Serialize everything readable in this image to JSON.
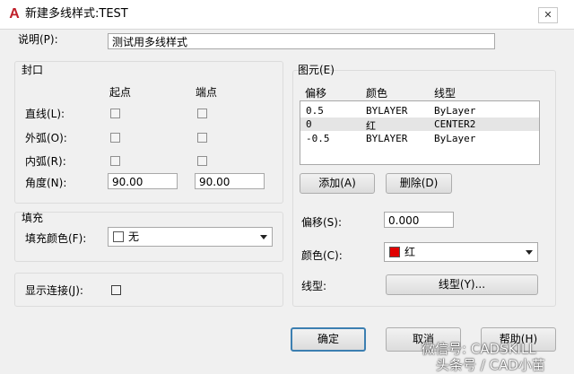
{
  "window": {
    "title": "新建多线样式:TEST",
    "close_glyph": "✕",
    "app_icon_glyph": "A"
  },
  "description": {
    "label": "说明(P):",
    "value": "测试用多线样式"
  },
  "caps": {
    "group_label": "封口",
    "col_start": "起点",
    "col_end": "端点",
    "rows": [
      {
        "label": "直线(L):",
        "start_checked": false,
        "end_checked": false
      },
      {
        "label": "外弧(O):",
        "start_checked": false,
        "end_checked": false
      },
      {
        "label": "内弧(R):",
        "start_checked": false,
        "end_checked": false
      }
    ],
    "angle_label": "角度(N):",
    "angle_start": "90.00",
    "angle_end": "90.00"
  },
  "fill": {
    "group_label": "填充",
    "color_label": "填充颜色(F):",
    "color_value": "无",
    "swatch_color": "#ffffff"
  },
  "joints": {
    "label": "显示连接(J):",
    "checked": false
  },
  "elements": {
    "group_label": "图元(E)",
    "headers": {
      "offset": "偏移",
      "color": "颜色",
      "linetype": "线型"
    },
    "rows": [
      {
        "offset": "0.5",
        "color": "BYLAYER",
        "linetype": "ByLayer"
      },
      {
        "offset": "0",
        "color": "红",
        "linetype": "CENTER2"
      },
      {
        "offset": "-0.5",
        "color": "BYLAYER",
        "linetype": "ByLayer"
      }
    ],
    "add_button": "添加(A)",
    "delete_button": "删除(D)",
    "offset_label": "偏移(S):",
    "offset_value": "0.000",
    "color_label": "颜色(C):",
    "color_value": "红",
    "color_swatch": "#e00000",
    "linetype_label": "线型:",
    "linetype_button": "线型(Y)..."
  },
  "footer": {
    "ok": "确定",
    "cancel": "取消",
    "help": "帮助(H)"
  },
  "watermark": {
    "line1": "微信号: CADSKILL",
    "line2": "头条号 / CAD小苗"
  }
}
